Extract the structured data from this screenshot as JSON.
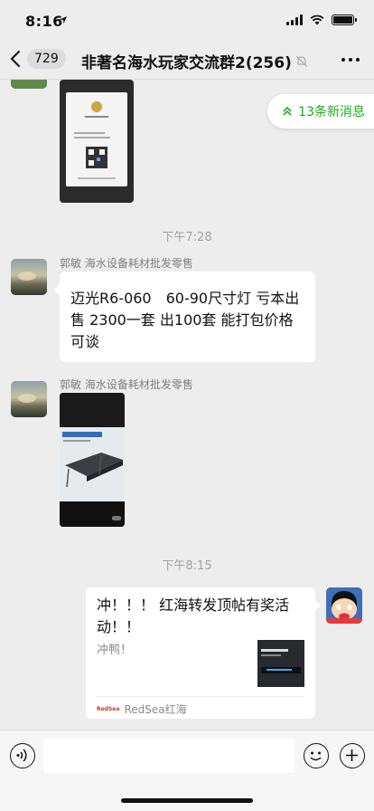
{
  "status_bar": {
    "time": "8:16"
  },
  "nav": {
    "unread_count": "729",
    "title": "非著名海水玩家交流群2(256)"
  },
  "chat": {
    "new_messages_label": "13条新消息",
    "messages": [
      {
        "type": "time",
        "text": "下午7:28"
      },
      {
        "type": "text",
        "sender": "郭敏 海水设备耗材批发零售",
        "text": "迈光R6-060　60-90尺寸灯 亏本出售 2300一套 出100套 能打包价格可谈"
      },
      {
        "type": "image",
        "sender": "郭敏 海水设备耗材批发零售"
      },
      {
        "type": "time",
        "text": "下午8:15"
      },
      {
        "type": "link",
        "title": "冲！！！ 红海转发顶帖有奖活动！！",
        "desc": "冲鸭！",
        "source": "RedSea红海",
        "source_logo": "RedSea"
      }
    ]
  },
  "colors": {
    "background": "#ededed",
    "accent_green": "#1aad19",
    "bubble": "#ffffff"
  }
}
